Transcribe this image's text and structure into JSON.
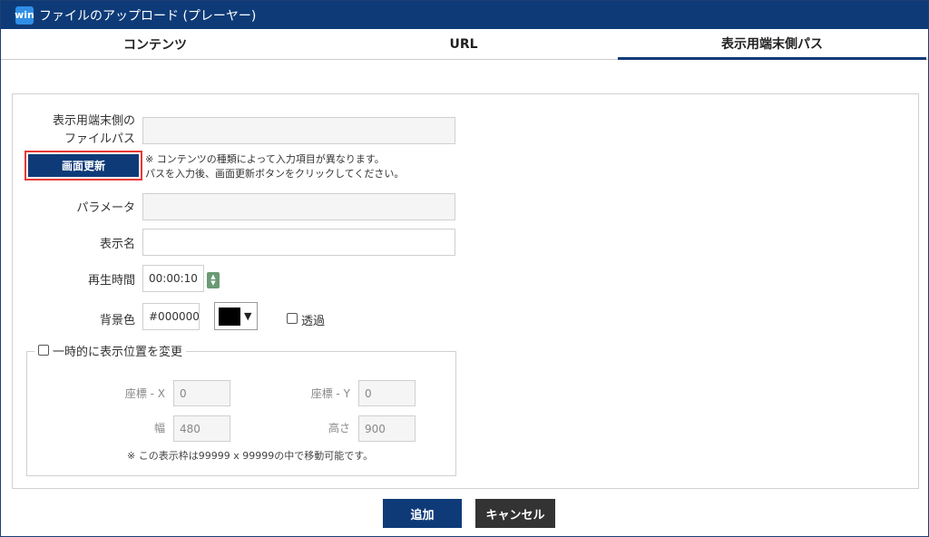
{
  "window": {
    "app_icon_text": "win",
    "title": "ファイルのアップロード (プレーヤー)"
  },
  "tabs": [
    {
      "label": "コンテンツ",
      "active": false
    },
    {
      "label": "URL",
      "active": false
    },
    {
      "label": "表示用端末側パス",
      "active": true
    }
  ],
  "form": {
    "path_label_line1": "表示用端末側の",
    "path_label_line2": "ファイルパス",
    "path_value": "",
    "refresh_button": "画面更新",
    "note_line1": "※ コンテンツの種類によって入力項目が異なります。",
    "note_line2": "パスを入力後、画面更新ボタンをクリックしてください。",
    "param_label": "パラメータ",
    "param_value": "",
    "display_name_label": "表示名",
    "display_name_value": "",
    "duration_label": "再生時間",
    "duration_value": "00:00:10",
    "bg_color_label": "背景色",
    "bg_color_value": "#000000",
    "bg_color_swatch": "#000000",
    "transparent_label": "透過",
    "transparent_checked": false
  },
  "position": {
    "legend": "一時的に表示位置を変更",
    "enabled": false,
    "x_label": "座標 - X",
    "x_value": "0",
    "y_label": "座標 - Y",
    "y_value": "0",
    "width_label": "幅",
    "width_value": "480",
    "height_label": "高さ",
    "height_value": "900",
    "note": "※ この表示枠は99999 x 99999の中で移動可能です。"
  },
  "footer": {
    "add_button": "追加",
    "cancel_button": "キャンセル"
  },
  "colors": {
    "titlebar": "#0e3b78",
    "primary_button": "#0e3b78",
    "cancel_button": "#333333",
    "highlight_border": "#e53935"
  }
}
